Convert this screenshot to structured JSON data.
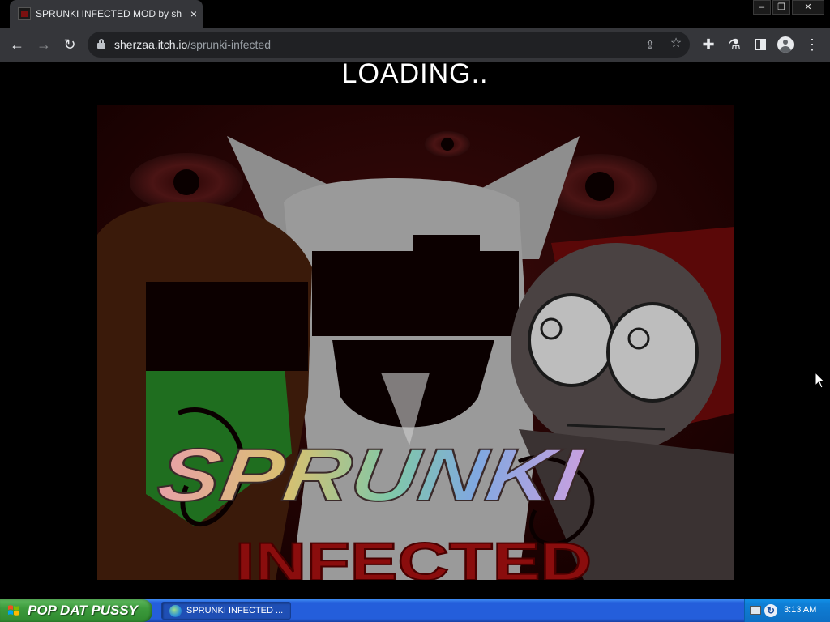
{
  "browser": {
    "tab": {
      "title": "SPRUNKI INFECTED MOD by sherza",
      "close_icon": "×"
    },
    "window_controls": {
      "minimize": "–",
      "restore": "❐",
      "close": "✕"
    },
    "toolbar": {
      "back_icon": "←",
      "forward_icon": "→",
      "reload_icon": "↻",
      "url_host": "sherzaa.itch.io",
      "url_path": "/sprunki-infected",
      "share_icon": "⇪",
      "star_icon": "☆",
      "extensions_icon": "✚",
      "labs_icon": "⚗",
      "menu_icon": "⋮"
    }
  },
  "page": {
    "loading_text": "LOADING..",
    "game_title": "SPRUNKI",
    "game_subtitle": "INFECTED"
  },
  "taskbar": {
    "start_label": "POP DAT PUSSY",
    "task_item_label": "SPRUNKI INFECTED ...",
    "tray_net_icon": "↻",
    "clock": "3:13 AM"
  },
  "colors": {
    "tab_bg": "#35363a",
    "toolbar_bg": "#35363a",
    "omnibox_bg": "#202124",
    "taskbar_blue": "#245edb",
    "start_green": "#3c9a3c",
    "art_dark_red": "#1a0000",
    "infected_red": "#8a0d0d"
  }
}
